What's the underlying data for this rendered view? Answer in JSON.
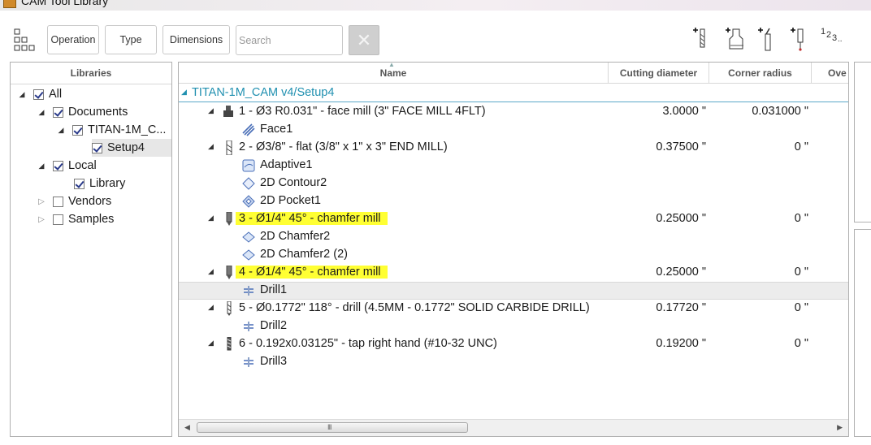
{
  "window": {
    "title": "CAM Tool Library"
  },
  "toolbar": {
    "operation_label": "Operation",
    "type_label": "Type",
    "dimensions_label": "Dimensions",
    "search_placeholder": "Search",
    "numbering_label": "1 2 3",
    "icons": [
      "grid-view-icon",
      "new-mill-tool-icon",
      "new-holder-icon",
      "new-turning-tool-icon",
      "new-probe-icon",
      "renumber-icon"
    ]
  },
  "libraries": {
    "header": "Libraries",
    "tree": [
      {
        "label": "All",
        "checked": true,
        "expanded": true,
        "depth": 0
      },
      {
        "label": "Documents",
        "checked": true,
        "expanded": true,
        "depth": 1
      },
      {
        "label": "TITAN-1M_C...",
        "checked": true,
        "expanded": true,
        "depth": 2
      },
      {
        "label": "Setup4",
        "checked": true,
        "depth": 3,
        "selected": true
      },
      {
        "label": "Local",
        "checked": true,
        "expanded": true,
        "depth": 1
      },
      {
        "label": "Library",
        "checked": true,
        "depth": 2
      },
      {
        "label": "Vendors",
        "checked": false,
        "expanded": false,
        "depth": 1
      },
      {
        "label": "Samples",
        "checked": false,
        "expanded": false,
        "depth": 1
      }
    ]
  },
  "tools_table": {
    "columns": [
      "Name",
      "Cutting diameter",
      "Corner radius",
      "Ove"
    ],
    "group": "TITAN-1M_CAM v4/Setup4",
    "rows": [
      {
        "kind": "tool",
        "name": "1 - Ø3 R0.031\" - face mill (3\" FACE MILL 4FLT)",
        "cutting_diameter": "3.0000 \"",
        "corner_radius": "0.031000 \"",
        "icon": "face-mill-icon"
      },
      {
        "kind": "op",
        "name": "Face1",
        "icon": "face-operation-icon"
      },
      {
        "kind": "tool",
        "name": "2 - Ø3/8\" - flat (3/8\" x 1\" x 3\" END MILL)",
        "cutting_diameter": "0.37500 \"",
        "corner_radius": "0 \"",
        "icon": "flat-end-mill-icon"
      },
      {
        "kind": "op",
        "name": "Adaptive1",
        "icon": "adaptive-operation-icon"
      },
      {
        "kind": "op",
        "name": "2D Contour2",
        "icon": "contour-operation-icon"
      },
      {
        "kind": "op",
        "name": "2D Pocket1",
        "icon": "pocket-operation-icon"
      },
      {
        "kind": "tool",
        "name": "3 - Ø1/4\" 45° - chamfer mill",
        "cutting_diameter": "0.25000 \"",
        "corner_radius": "0 \"",
        "highlight": true,
        "icon": "chamfer-mill-icon"
      },
      {
        "kind": "op",
        "name": "2D Chamfer2",
        "icon": "chamfer-operation-icon"
      },
      {
        "kind": "op",
        "name": "2D Chamfer2 (2)",
        "icon": "chamfer-operation-icon"
      },
      {
        "kind": "tool",
        "name": "4 - Ø1/4\" 45° - chamfer mill",
        "cutting_diameter": "0.25000 \"",
        "corner_radius": "0 \"",
        "highlight": true,
        "icon": "chamfer-mill-icon"
      },
      {
        "kind": "op",
        "name": "Drill1",
        "selected": true,
        "icon": "drill-operation-icon"
      },
      {
        "kind": "tool",
        "name": "5 - Ø0.1772\" 118° - drill (4.5MM - 0.1772\" SOLID CARBIDE DRILL)",
        "cutting_diameter": "0.17720 \"",
        "corner_radius": "0 \"",
        "icon": "drill-tool-icon"
      },
      {
        "kind": "op",
        "name": "Drill2",
        "icon": "drill-operation-icon"
      },
      {
        "kind": "tool",
        "name": "6 - 0.192x0.03125\" - tap right hand (#10-32 UNC)",
        "cutting_diameter": "0.19200 \"",
        "corner_radius": "0 \"",
        "icon": "tap-tool-icon"
      },
      {
        "kind": "op",
        "name": "Drill3",
        "icon": "drill-operation-icon"
      }
    ],
    "scrollbar_grip": "III"
  },
  "colors": {
    "group_label": "#2090b0",
    "highlight": "#ffff33",
    "selected_row": "#e7e7e7"
  }
}
